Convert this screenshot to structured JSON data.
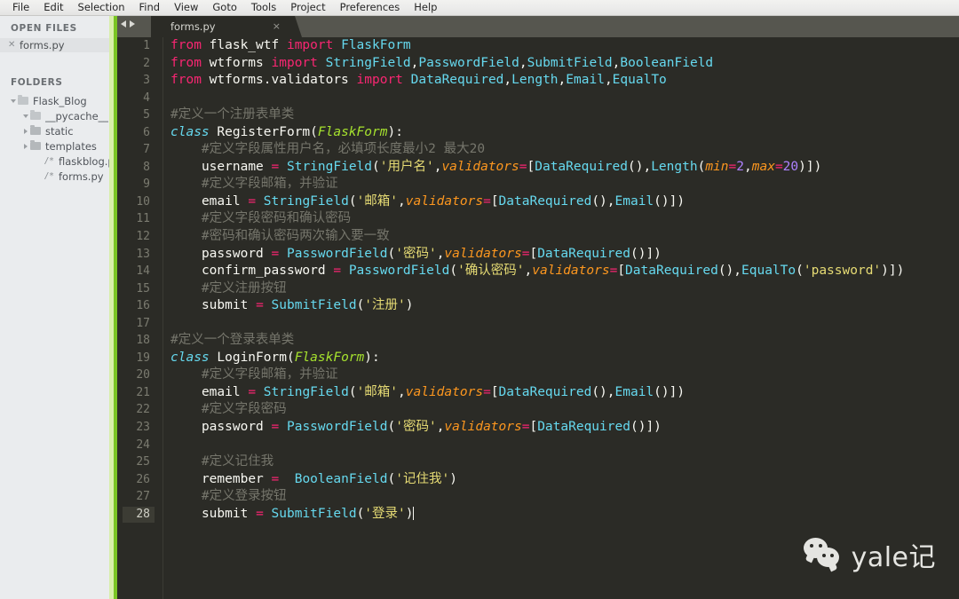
{
  "menu": {
    "items": [
      {
        "label": "File"
      },
      {
        "label": "Edit"
      },
      {
        "label": "Selection"
      },
      {
        "label": "Find"
      },
      {
        "label": "View"
      },
      {
        "label": "Goto"
      },
      {
        "label": "Tools"
      },
      {
        "label": "Project"
      },
      {
        "label": "Preferences"
      },
      {
        "label": "Help"
      }
    ]
  },
  "sidebar": {
    "open_files_header": "OPEN FILES",
    "open_files": [
      {
        "label": "forms.py",
        "close_icon": "close-icon"
      }
    ],
    "folders_header": "FOLDERS",
    "tree": [
      {
        "label": "Flask_Blog",
        "depth": 0,
        "kind": "folder-open",
        "twisty": "down",
        "icon": "folder-open-icon"
      },
      {
        "label": "__pycache__",
        "depth": 1,
        "kind": "folder-open",
        "twisty": "down",
        "icon": "folder-open-icon"
      },
      {
        "label": "static",
        "depth": 1,
        "kind": "folder-closed",
        "twisty": "right",
        "icon": "folder-icon"
      },
      {
        "label": "templates",
        "depth": 1,
        "kind": "folder-closed",
        "twisty": "right",
        "icon": "folder-icon"
      },
      {
        "label": "flaskblog.py",
        "depth": 2,
        "kind": "file",
        "twisty": "none",
        "icon": "file-icon",
        "glyph": "/*"
      },
      {
        "label": "forms.py",
        "depth": 2,
        "kind": "file",
        "twisty": "none",
        "icon": "file-icon",
        "glyph": "/*"
      }
    ]
  },
  "tabbar": {
    "nav_prev_icon": "arrow-left-icon",
    "nav_next_icon": "arrow-right-icon",
    "tabs": [
      {
        "label": "forms.py",
        "active": true,
        "close_icon": "close-icon",
        "close_glyph": "×"
      }
    ]
  },
  "editor": {
    "filename": "forms.py",
    "language": "Python",
    "active_line": 28,
    "first_line": 1,
    "last_line": 28,
    "lines": [
      {
        "n": 1,
        "text": "from flask_wtf import FlaskForm"
      },
      {
        "n": 2,
        "text": "from wtforms import StringField,PasswordField,SubmitField,BooleanField"
      },
      {
        "n": 3,
        "text": "from wtforms.validators import DataRequired,Length,Email,EqualTo"
      },
      {
        "n": 4,
        "text": ""
      },
      {
        "n": 5,
        "text": "#定义一个注册表单类"
      },
      {
        "n": 6,
        "text": "class RegisterForm(FlaskForm):"
      },
      {
        "n": 7,
        "text": "    #定义字段属性用户名，必填项长度最小2 最大20"
      },
      {
        "n": 8,
        "text": "    username = StringField('用户名',validators=[DataRequired(),Length(min=2,max=20)])"
      },
      {
        "n": 9,
        "text": "    #定义字段邮箱，并验证"
      },
      {
        "n": 10,
        "text": "    email = StringField('邮箱',validators=[DataRequired(),Email()])"
      },
      {
        "n": 11,
        "text": "    #定义字段密码和确认密码"
      },
      {
        "n": 12,
        "text": "    #密码和确认密码两次输入要一致"
      },
      {
        "n": 13,
        "text": "    password = PasswordField('密码',validators=[DataRequired()])"
      },
      {
        "n": 14,
        "text": "    confirm_password = PasswordField('确认密码',validators=[DataRequired(),EqualTo('password')])"
      },
      {
        "n": 15,
        "text": "    #定义注册按钮"
      },
      {
        "n": 16,
        "text": "    submit = SubmitField('注册')"
      },
      {
        "n": 17,
        "text": ""
      },
      {
        "n": 18,
        "text": "#定义一个登录表单类"
      },
      {
        "n": 19,
        "text": "class LoginForm(FlaskForm):"
      },
      {
        "n": 20,
        "text": "    #定义字段邮箱，并验证"
      },
      {
        "n": 21,
        "text": "    email = StringField('邮箱',validators=[DataRequired(),Email()])"
      },
      {
        "n": 22,
        "text": "    #定义字段密码"
      },
      {
        "n": 23,
        "text": "    password = PasswordField('密码',validators=[DataRequired()])"
      },
      {
        "n": 24,
        "text": ""
      },
      {
        "n": 25,
        "text": "    #定义记住我"
      },
      {
        "n": 26,
        "text": "    remember =  BooleanField('记住我')"
      },
      {
        "n": 27,
        "text": "    #定义登录按钮"
      },
      {
        "n": 28,
        "text": "    submit = SubmitField('登录')"
      }
    ]
  },
  "watermark": {
    "text": "yale记",
    "icon": "wechat-icon"
  },
  "colors": {
    "editor_bg": "#2b2b26",
    "sidebar_bg": "#eaecee",
    "menubar_bg": "#ececeb",
    "tabstrip_bg": "#56564f",
    "divider_green": "#7ac524",
    "divider_pale": "#d8efaa",
    "keyword": "#f92672",
    "class_keyword": "#66d9ef",
    "class_name": "#a6e22e",
    "function": "#66d9ef",
    "string": "#e6db74",
    "comment": "#76766c",
    "argument": "#fd971f",
    "number": "#ae81ff",
    "text": "#f8f8f2"
  }
}
